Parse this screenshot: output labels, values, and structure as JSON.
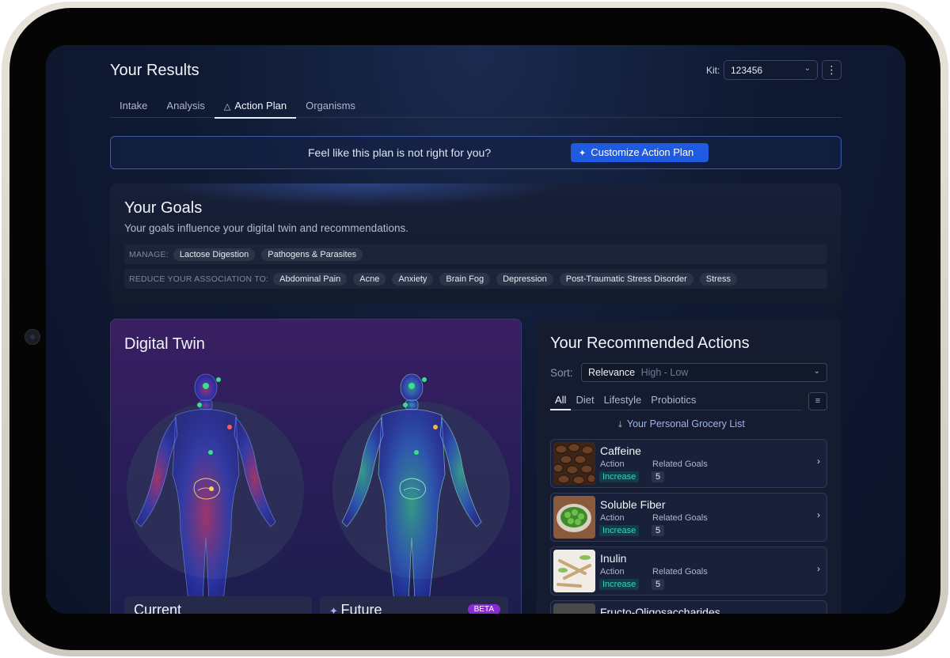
{
  "header": {
    "title": "Your Results",
    "kit_label": "Kit:",
    "kit_value": "123456",
    "more_icon": "vertical-ellipsis-icon"
  },
  "tabs": [
    {
      "label": "Intake"
    },
    {
      "label": "Analysis"
    },
    {
      "label": "Action Plan",
      "active": true,
      "icon": "network-icon"
    },
    {
      "label": "Organisms"
    }
  ],
  "banner": {
    "text": "Feel like this plan is not right for you?",
    "button": "Customize Action Plan"
  },
  "goals": {
    "title": "Your Goals",
    "subtitle": "Your goals influence your digital twin and recommendations.",
    "manage_label": "MANAGE:",
    "manage": [
      "Lactose Digestion",
      "Pathogens & Parasites"
    ],
    "reduce_label": "REDUCE YOUR ASSOCIATION TO:",
    "reduce": [
      "Abdominal Pain",
      "Acne",
      "Anxiety",
      "Brain Fog",
      "Depression",
      "Post-Traumatic Stress Disorder",
      "Stress"
    ]
  },
  "twin": {
    "title": "Digital Twin",
    "current_label": "Current",
    "future_label": "Future",
    "beta": "BETA"
  },
  "actions": {
    "title": "Your Recommended Actions",
    "sort_label": "Sort:",
    "sort_value": "Relevance",
    "sort_order": "High - Low",
    "filters": [
      "All",
      "Diet",
      "Lifestyle",
      "Probiotics"
    ],
    "grocery": "Your Personal Grocery List",
    "action_col": "Action",
    "goals_col": "Related Goals",
    "items": [
      {
        "name": "Caffeine",
        "action": "Increase",
        "goals": "5"
      },
      {
        "name": "Soluble Fiber",
        "action": "Increase",
        "goals": "5"
      },
      {
        "name": "Inulin",
        "action": "Increase",
        "goals": "5"
      },
      {
        "name": "Fructo-Oligosaccharides"
      }
    ]
  },
  "colors": {
    "accent": "#1f5be0",
    "increase": "#39d3c7",
    "beta": "#8a2bd6"
  }
}
